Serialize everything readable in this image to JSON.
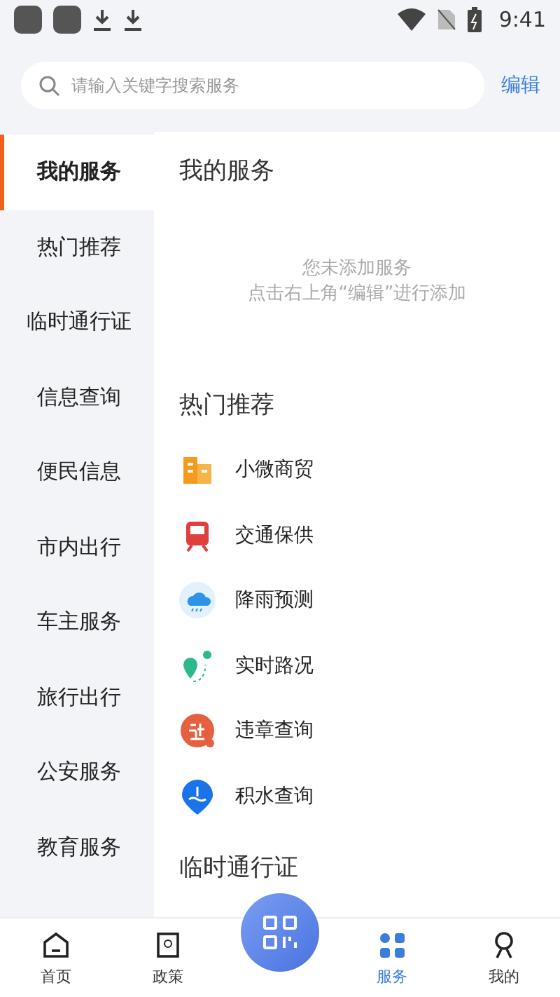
{
  "status_bar": {
    "time": "9:41"
  },
  "search": {
    "placeholder": "请输入关键字搜索服务",
    "action": "编辑"
  },
  "sidebar": {
    "items": [
      {
        "label": "我的服务",
        "selected": true
      },
      {
        "label": "热门推荐",
        "selected": false
      },
      {
        "label": "临时通行证",
        "selected": false
      },
      {
        "label": "信息查询",
        "selected": false
      },
      {
        "label": "便民信息",
        "selected": false
      },
      {
        "label": "市内出行",
        "selected": false
      },
      {
        "label": "车主服务",
        "selected": false
      },
      {
        "label": "旅行出行",
        "selected": false
      },
      {
        "label": "公安服务",
        "selected": false
      },
      {
        "label": "教育服务",
        "selected": false
      }
    ]
  },
  "sections": [
    {
      "title": "我的服务",
      "empty_lines": [
        "您未添加服务",
        "点击右上角“编辑”进行添加"
      ]
    },
    {
      "title": "热门推荐",
      "services": [
        {
          "label": "小微商贸",
          "kind": "building"
        },
        {
          "label": "交通保供",
          "kind": "train"
        },
        {
          "label": "降雨预测",
          "kind": "rain"
        },
        {
          "label": "实时路况",
          "kind": "route"
        },
        {
          "label": "违章查询",
          "kind": "violation"
        },
        {
          "label": "积水查询",
          "kind": "water"
        }
      ]
    },
    {
      "title": "临时通行证"
    }
  ],
  "bottom_nav": [
    {
      "label": "首页",
      "kind": "home",
      "selected": false
    },
    {
      "label": "政策",
      "kind": "policy",
      "selected": false
    },
    {
      "kind": "scan"
    },
    {
      "label": "服务",
      "kind": "services",
      "selected": true
    },
    {
      "label": "我的",
      "kind": "me",
      "selected": false
    }
  ]
}
